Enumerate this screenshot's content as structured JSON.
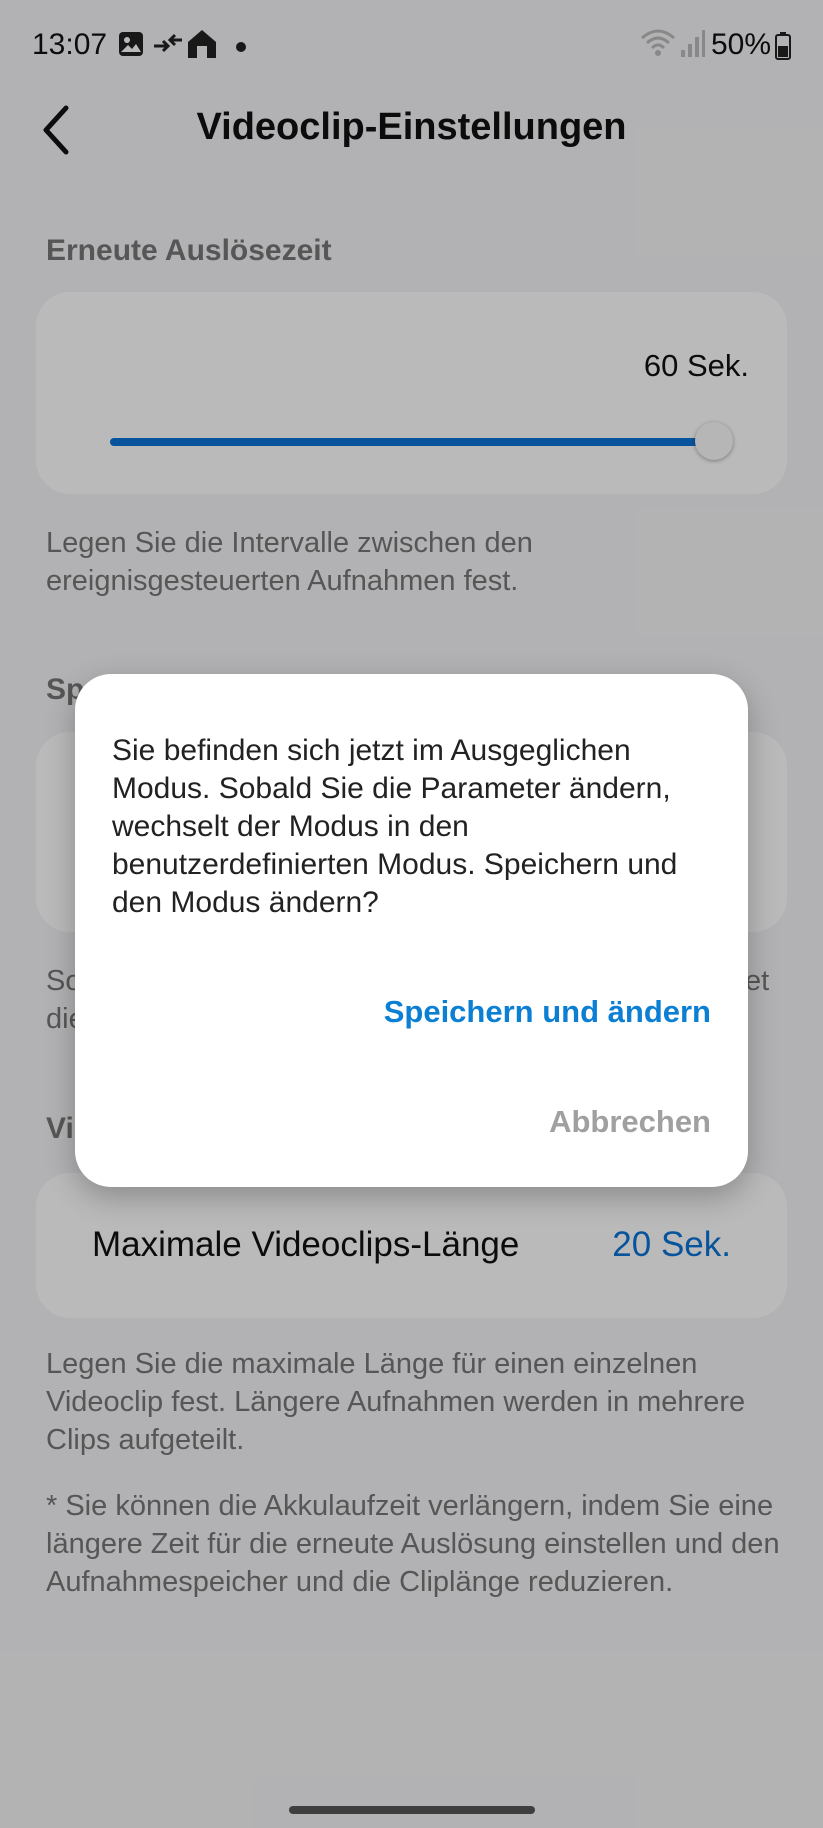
{
  "status_bar": {
    "time": "13:07",
    "battery_percent": "50%",
    "icons": [
      "gallery-icon",
      "usb-transfer-icon",
      "home-icon",
      "notification-dot-icon",
      "wifi-icon",
      "cellular-signal-icon",
      "battery-icon"
    ]
  },
  "header": {
    "title": "Videoclip-Einstellungen",
    "back_icon": "chevron-left-icon"
  },
  "sections": {
    "retrigger": {
      "label": "Erneute Auslösezeit",
      "value": "60 Sek.",
      "slider_fraction": 1.0,
      "description": "Legen Sie die Intervalle zwischen den ereignisgesteuerten Aufnahmen fest."
    },
    "video": {
      "row_label": "Maximale Videoclips-Länge",
      "row_value": "20 Sek.",
      "description": "Legen Sie die maximale Länge für einen einzelnen Videoclip fest. Längere Aufnahmen werden in mehrere Clips aufgeteilt.",
      "note": "* Sie können die Akkulaufzeit verlängern, indem Sie eine längere Zeit für die erneute Auslösung einstellen und den Aufnahmespeicher und die Cliplänge reduzieren."
    },
    "partially_hidden": {
      "label_fragment_1": "Sp",
      "desc_fragment_1": "So",
      "desc_fragment_2": "die",
      "desc_fragment_3": "et",
      "label_fragment_2": "Vi"
    }
  },
  "dialog": {
    "message": "Sie befinden sich jetzt im Ausgeglichen Modus. Sobald Sie die Parameter ändern, wechselt der Modus in den benutzerdefinierten Modus. Speichern und den Modus ändern?",
    "confirm_label": "Speichern und ändern",
    "cancel_label": "Abbrechen"
  },
  "colors": {
    "accent": "#0b74d6",
    "background": "#f5f5f7",
    "scrim": "rgba(0,0,0,0.27)"
  }
}
